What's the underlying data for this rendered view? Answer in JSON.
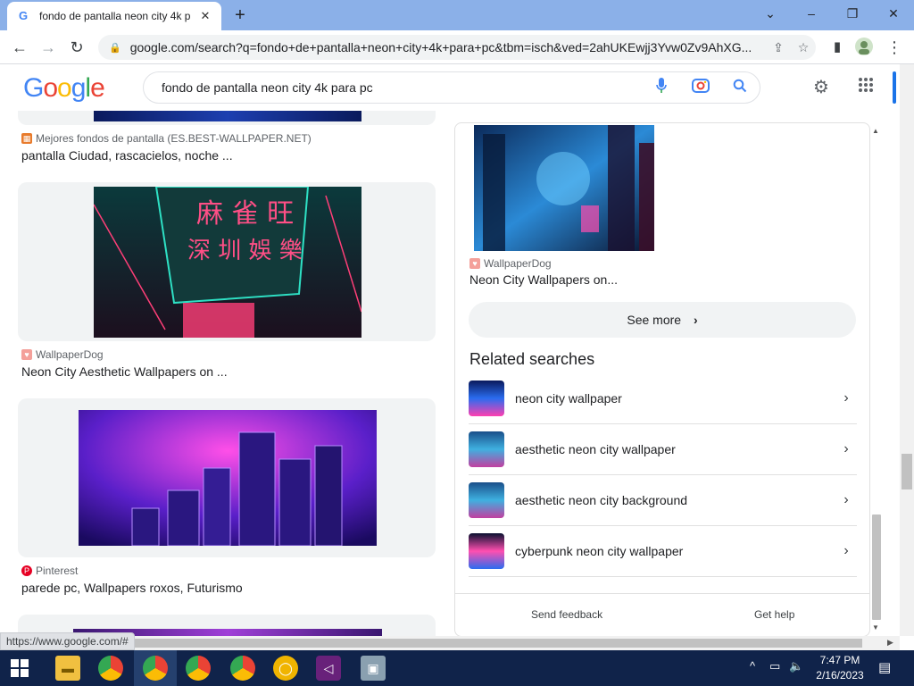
{
  "browser": {
    "tab_title": "fondo de pantalla neon city 4k p",
    "url": "google.com/search?q=fondo+de+pantalla+neon+city+4k+para+pc&tbm=isch&ved=2ahUKEwjj3Yvw0Zv9AhXG..."
  },
  "header": {
    "logo": "Google",
    "query": "fondo de pantalla neon city 4k para pc"
  },
  "results": [
    {
      "source": "Mejores fondos de pantalla (ES.BEST-WALLPAPER.NET)",
      "caption": "pantalla Ciudad, rascacielos, noche ..."
    },
    {
      "source": "WallpaperDog",
      "caption": "Neon City Aesthetic Wallpapers on ..."
    },
    {
      "source": "Pinterest",
      "caption": "parede pc, Wallpapers roxos, Futurismo"
    }
  ],
  "panel": {
    "source": "WallpaperDog",
    "caption": "Neon City Wallpapers on...",
    "see_more": "See more",
    "related_title": "Related searches",
    "related": [
      {
        "label": "neon city wallpaper"
      },
      {
        "label": "aesthetic neon city wallpaper"
      },
      {
        "label": "aesthetic neon city background"
      },
      {
        "label": "cyberpunk neon city wallpaper"
      }
    ],
    "send_feedback": "Send feedback",
    "get_help": "Get help"
  },
  "status_url": "https://www.google.com/#",
  "taskbar": {
    "time": "7:47 PM",
    "date": "2/16/2023"
  },
  "colors": {
    "tabbar": "#8bb0e8",
    "taskbar": "#10234a",
    "accent": "#1a73e8"
  }
}
